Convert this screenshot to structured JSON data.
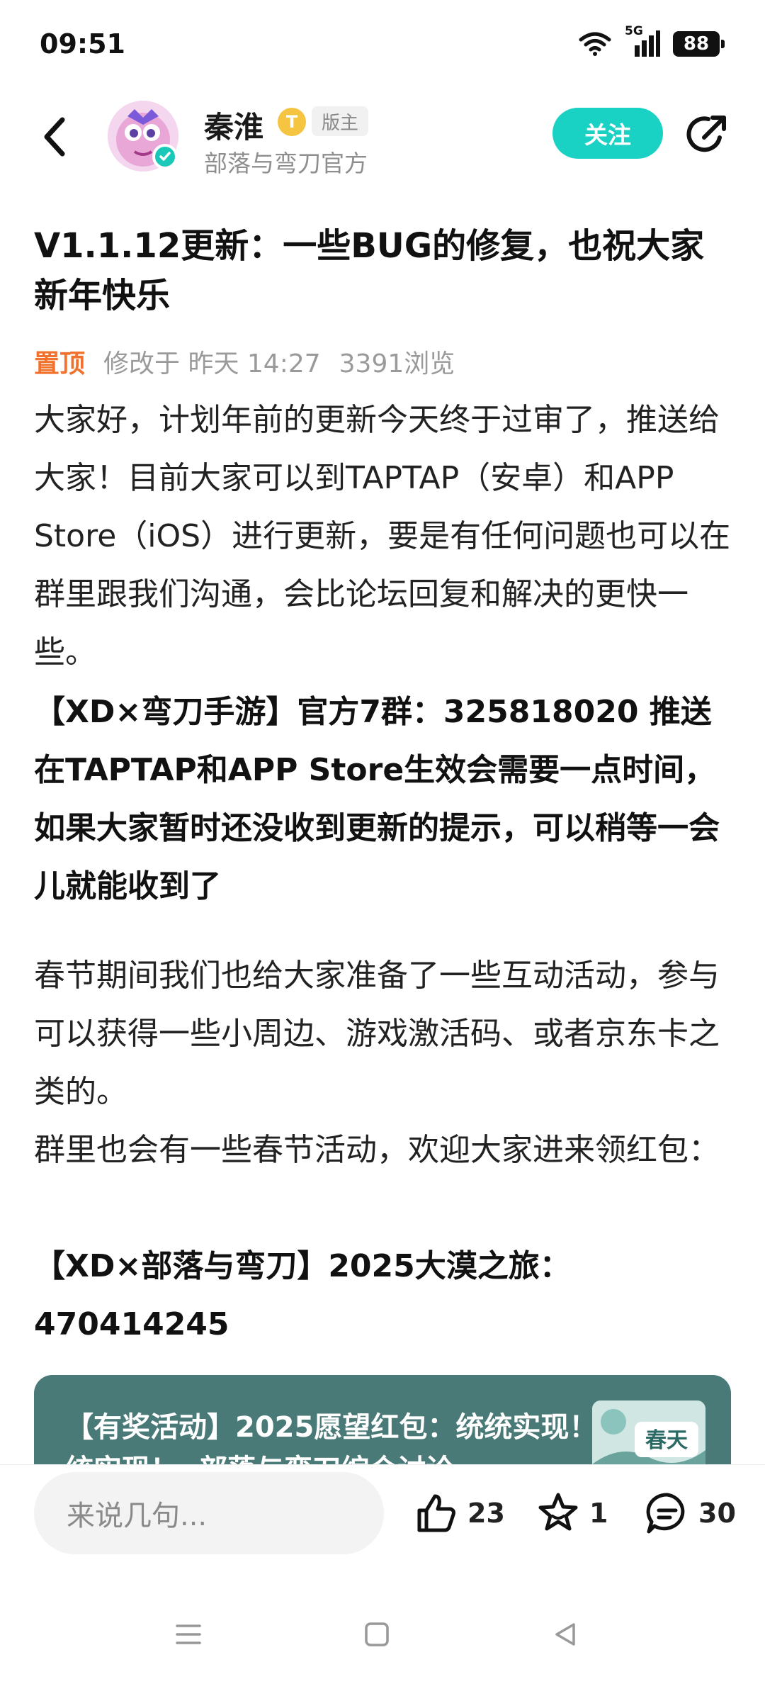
{
  "status_bar": {
    "time": "09:51",
    "network": "5G",
    "battery": "88",
    "icons": [
      "wifi-icon",
      "signal-icon",
      "battery-icon"
    ]
  },
  "header": {
    "author_name": "秦淮",
    "level_badge": "T",
    "role_badge": "版主",
    "author_sub": "部落与弯刀官方",
    "follow_label": "关注",
    "accent_color": "#19d2c4"
  },
  "post": {
    "title": "V1.1.12更新：一些BUG的修复，也祝大家新年快乐",
    "pinned": "置顶",
    "modified": "修改于 昨天 14:27",
    "views": "3391浏览",
    "paragraph_1": "大家好，计划年前的更新今天终于过审了，推送给大家！目前大家可以到TAPTAP（安卓）和APP Store（iOS）进行更新，要是有任何问题也可以在群里跟我们沟通，会比论坛回复和解决的更快一些。",
    "paragraph_2": "【XD×弯刀手游】官方7群：325818020 推送在TAPTAP和APP Store生效会需要一点时间，如果大家暂时还没收到更新的提示，可以稍等一会儿就能收到了",
    "paragraph_3": "春节期间我们也给大家准备了一些互动活动，参与可以获得一些小周边、游戏激活码、或者京东卡之类的。",
    "paragraph_4": "群里也会有一些春节活动，欢迎大家进来领红包：",
    "paragraph_5": "【XD×部落与弯刀】2025大漠之旅：470414245"
  },
  "link_card": {
    "title": "【有奖活动】2025愿望红包：统统实现！",
    "title_partial": "统实现！· 部落与弯刀综合讨论",
    "thumb_text": "春天"
  },
  "bottom_bar": {
    "comment_placeholder": "来说几句...",
    "likes": "23",
    "favorites": "1",
    "comments": "30"
  }
}
